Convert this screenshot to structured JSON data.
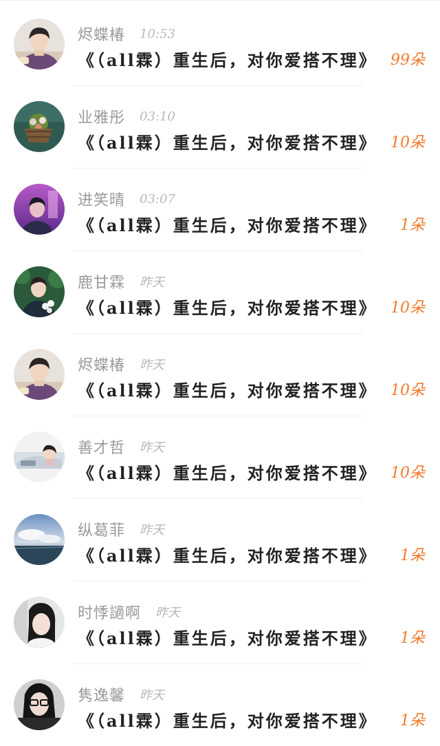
{
  "messages": [
    {
      "name": "烬蝶椿",
      "time": "10:53",
      "text": "《（all霖）重生后，对你爱搭不理》",
      "gift": "99朵",
      "avatar": "boy-purple-hoodie"
    },
    {
      "name": "业雅彤",
      "time": "03:10",
      "text": "《（all霖）重生后，对你爱搭不理》",
      "gift": "10朵",
      "avatar": "flower-basket"
    },
    {
      "name": "进笑晴",
      "time": "03:07",
      "text": "《（all霖）重生后，对你爱搭不理》",
      "gift": "1朵",
      "avatar": "boy-pink-sky"
    },
    {
      "name": "鹿甘霖",
      "time": "昨天",
      "text": "《（all霖）重生后，对你爱搭不理》",
      "gift": "10朵",
      "avatar": "boy-flowers"
    },
    {
      "name": "烬蝶椿",
      "time": "昨天",
      "text": "《（all霖）重生后，对你爱搭不理》",
      "gift": "10朵",
      "avatar": "boy-purple-hoodie"
    },
    {
      "name": "善才哲",
      "time": "昨天",
      "text": "《（all霖）重生后，对你爱搭不理》",
      "gift": "10朵",
      "avatar": "girl-car"
    },
    {
      "name": "纵葛菲",
      "time": "昨天",
      "text": "《（all霖）重生后，对你爱搭不理》",
      "gift": "1朵",
      "avatar": "ocean-sky"
    },
    {
      "name": "时悸讁啊",
      "time": "昨天",
      "text": "《（all霖）重生后，对你爱搭不理》",
      "gift": "1朵",
      "avatar": "girl-portrait"
    },
    {
      "name": "隽逸馨",
      "time": "昨天",
      "text": "《（all霖）重生后，对你爱搭不理》",
      "gift": "1朵",
      "avatar": "girl-glasses"
    }
  ]
}
